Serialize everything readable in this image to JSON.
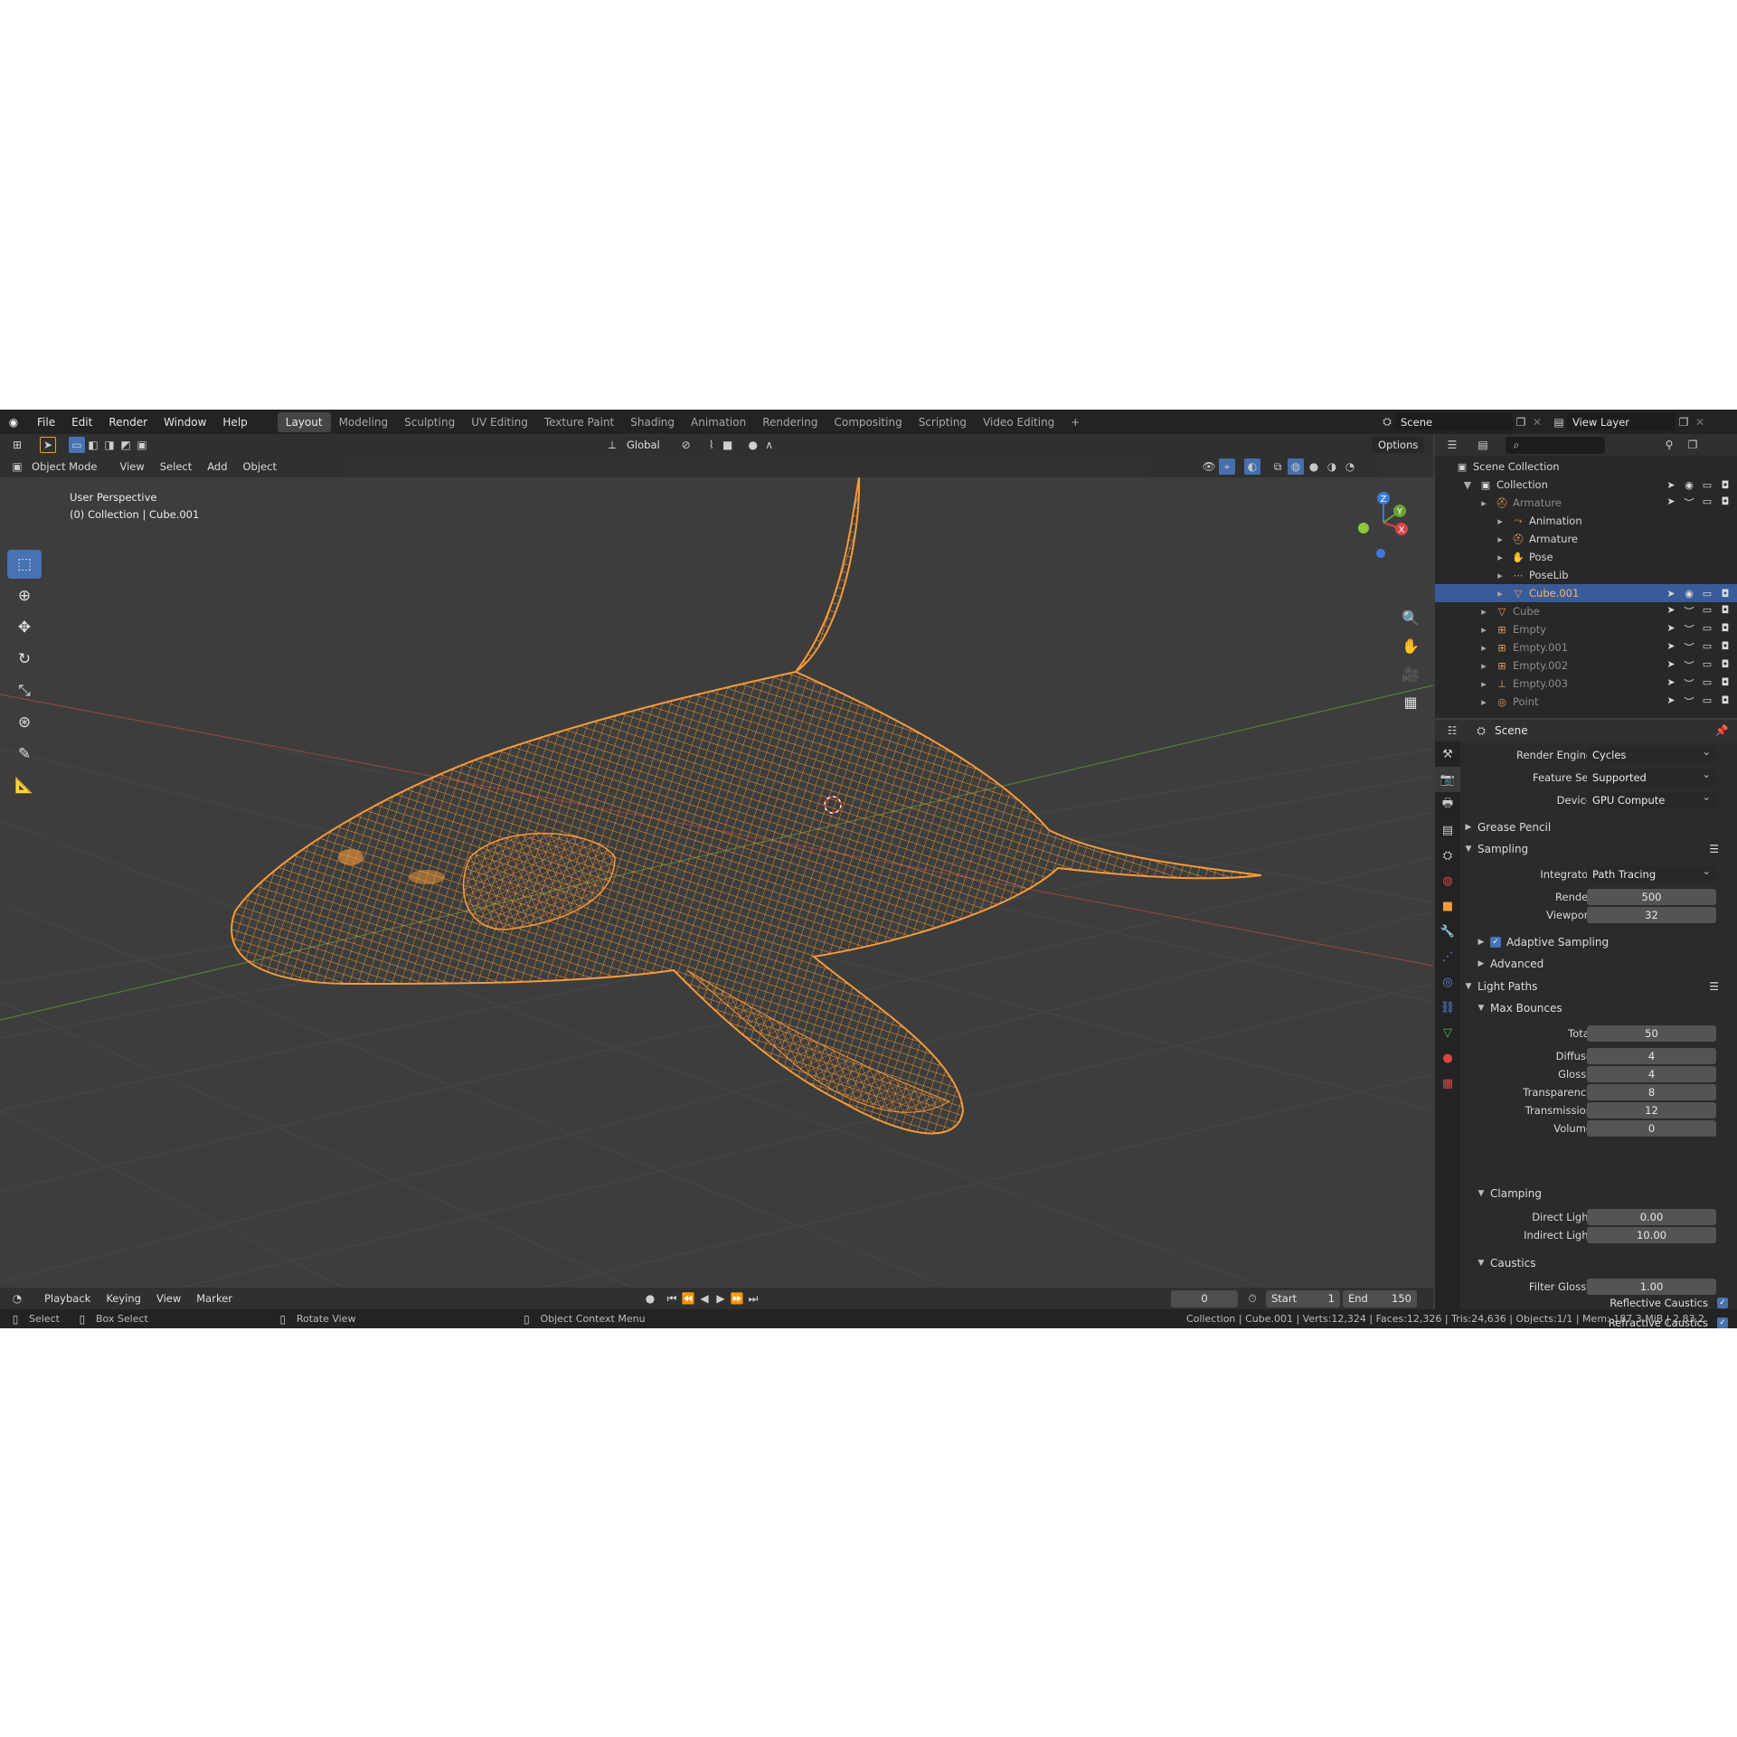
{
  "topbar": {
    "menu": [
      "File",
      "Edit",
      "Render",
      "Window",
      "Help"
    ],
    "workspaces": [
      "Layout",
      "Modeling",
      "Sculpting",
      "UV Editing",
      "Texture Paint",
      "Shading",
      "Animation",
      "Rendering",
      "Compositing",
      "Scripting",
      "Video Editing"
    ],
    "active_workspace": "Layout",
    "add_tab": "+",
    "scene": "Scene",
    "view_layer": "View Layer"
  },
  "tool_header": {
    "orientation": "Global",
    "options": "Options"
  },
  "viewport_header": {
    "mode": "Object Mode",
    "menus": [
      "View",
      "Select",
      "Add",
      "Object"
    ]
  },
  "viewport": {
    "perspective": "User Perspective",
    "collection_info": "(0) Collection | Cube.001",
    "accent": "#f59a3a",
    "gizmo_axes": {
      "z": "Z",
      "y": "Y",
      "x": "X"
    }
  },
  "outliner": {
    "scene_collection": "Scene Collection",
    "items": [
      {
        "label": "Collection",
        "indent": 1,
        "dim": false,
        "selected": false
      },
      {
        "label": "Armature",
        "indent": 2,
        "dim": true,
        "selected": false
      },
      {
        "label": "Animation",
        "indent": 3,
        "dim": false,
        "selected": false
      },
      {
        "label": "Armature",
        "indent": 3,
        "dim": false,
        "selected": false
      },
      {
        "label": "Pose",
        "indent": 3,
        "dim": false,
        "selected": false
      },
      {
        "label": "PoseLib",
        "indent": 3,
        "dim": false,
        "selected": false
      },
      {
        "label": "Cube.001",
        "indent": 3,
        "dim": false,
        "selected": true
      },
      {
        "label": "Cube",
        "indent": 2,
        "dim": true,
        "selected": false
      },
      {
        "label": "Empty",
        "indent": 2,
        "dim": true,
        "selected": false
      },
      {
        "label": "Empty.001",
        "indent": 2,
        "dim": true,
        "selected": false
      },
      {
        "label": "Empty.002",
        "indent": 2,
        "dim": true,
        "selected": false
      },
      {
        "label": "Empty.003",
        "indent": 2,
        "dim": true,
        "selected": false
      },
      {
        "label": "Point",
        "indent": 2,
        "dim": true,
        "selected": false
      }
    ]
  },
  "properties": {
    "context": "Scene",
    "render_engine_label": "Render Engine",
    "render_engine": "Cycles",
    "feature_set_label": "Feature Set",
    "feature_set": "Supported",
    "device_label": "Device",
    "device": "GPU Compute",
    "grease_pencil": "Grease Pencil",
    "sampling": "Sampling",
    "integrator_label": "Integrator",
    "integrator": "Path Tracing",
    "render_label": "Render",
    "render_samples": "500",
    "viewport_label": "Viewport",
    "viewport_samples": "32",
    "adaptive_sampling": "Adaptive Sampling",
    "advanced": "Advanced",
    "light_paths": "Light Paths",
    "max_bounces": "Max Bounces",
    "bounces": [
      {
        "label": "Total",
        "value": "50"
      },
      {
        "label": "Diffuse",
        "value": "4"
      },
      {
        "label": "Glossy",
        "value": "4"
      },
      {
        "label": "Transparency",
        "value": "8"
      },
      {
        "label": "Transmission",
        "value": "12"
      },
      {
        "label": "Volume",
        "value": "0"
      }
    ],
    "clamping": "Clamping",
    "direct_light_label": "Direct Light",
    "direct_light": "0.00",
    "indirect_light_label": "Indirect Light",
    "indirect_light": "10.00",
    "caustics": "Caustics",
    "filter_glossy_label": "Filter Glossy",
    "filter_glossy": "1.00",
    "reflective_caustics": "Reflective Caustics",
    "refractive_caustics": "Refractive Caustics"
  },
  "timeline": {
    "menus": [
      "Playback",
      "Keying",
      "View",
      "Marker"
    ],
    "current_frame": "0",
    "start_label": "Start",
    "start": "1",
    "end_label": "End",
    "end": "150"
  },
  "statusbar": {
    "select": "Select",
    "box_select": "Box Select",
    "rotate_view": "Rotate View",
    "context_menu": "Object Context Menu",
    "stats": "Collection | Cube.001 | Verts:12,324 | Faces:12,326 | Tris:24,636 | Objects:1/1 | Mem: 187.3 MiB | 2.83.2"
  }
}
